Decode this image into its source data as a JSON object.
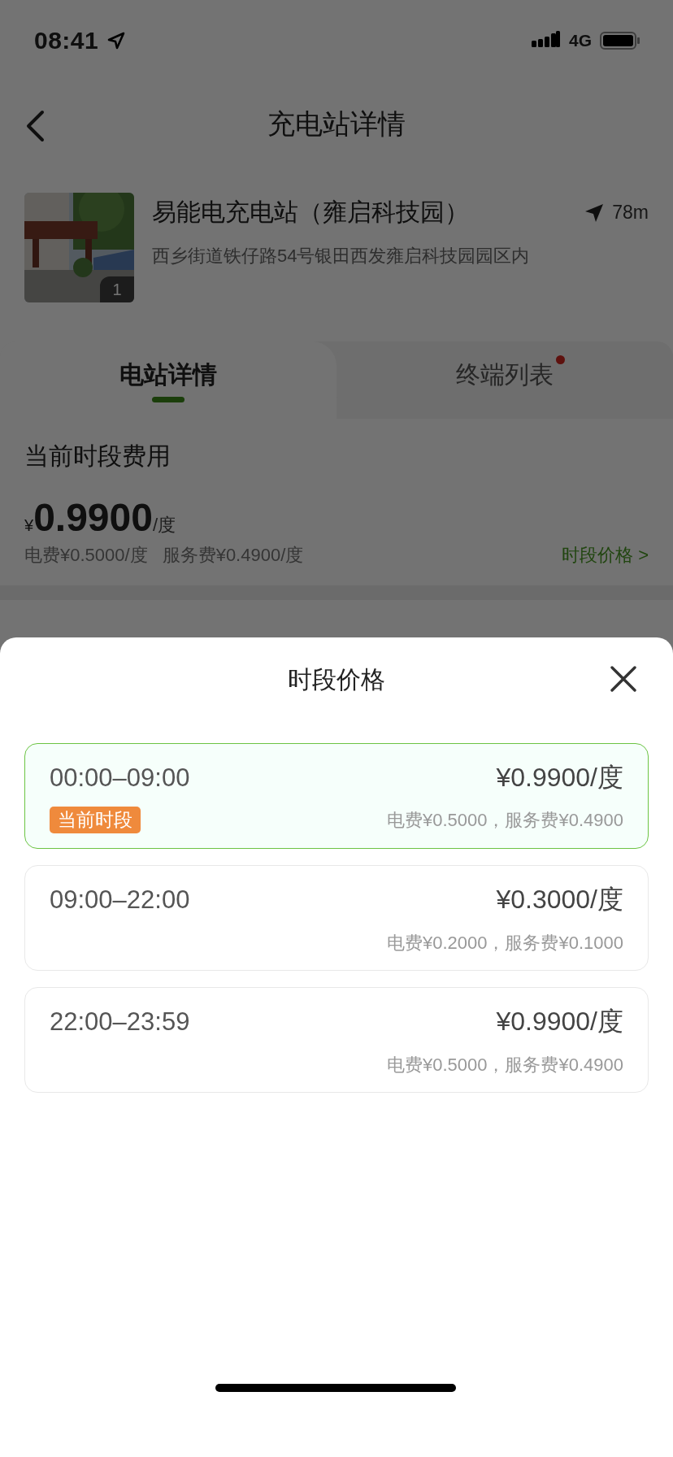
{
  "status_bar": {
    "time": "08:41",
    "network": "4G"
  },
  "nav": {
    "title": "充电站详情"
  },
  "station": {
    "photo_count": "1",
    "name": "易能电充电站（雍启科技园）",
    "distance": "78m",
    "address": "西乡街道铁仔路54号银田西发雍启科技园园区内"
  },
  "tabs": [
    {
      "label": "电站详情",
      "selected": true,
      "dot": false
    },
    {
      "label": "终端列表",
      "selected": false,
      "dot": true
    }
  ],
  "current_fee": {
    "title": "当前时段费用",
    "currency": "¥",
    "price": "0.9900",
    "unit": "/度",
    "breakdown": [
      "电费¥0.5000/度",
      "服务费¥0.4900/度"
    ],
    "link": "时段价格 >"
  },
  "sheet": {
    "title": "时段价格",
    "periods": [
      {
        "time": "00:00–09:00",
        "price": "¥0.9900/度",
        "breakdown": "电费¥0.5000，服务费¥0.4900",
        "selected": true,
        "tag": "当前时段"
      },
      {
        "time": "09:00–22:00",
        "price": "¥0.3000/度",
        "breakdown": "电费¥0.2000，服务费¥0.1000",
        "selected": false
      },
      {
        "time": "22:00–23:59",
        "price": "¥0.9900/度",
        "breakdown": "电费¥0.5000，服务费¥0.4900",
        "selected": false
      }
    ]
  }
}
